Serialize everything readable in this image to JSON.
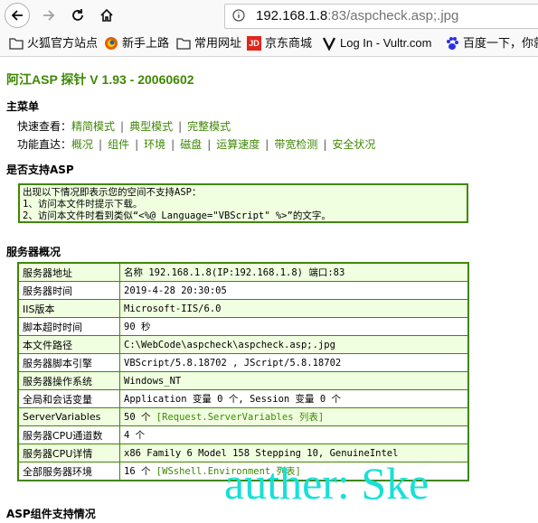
{
  "browser": {
    "url_host": "192.168.1.8",
    "url_rest": ":83/aspcheck.asp;.jpg"
  },
  "bookmarks": [
    {
      "label": "火狐官方站点",
      "icon": "folder-icon"
    },
    {
      "label": "新手上路",
      "icon": "firefox-icon"
    },
    {
      "label": "常用网址",
      "icon": "folder-icon"
    },
    {
      "label": "京东商城",
      "icon": "jd-icon"
    },
    {
      "label": "Log In - Vultr.com",
      "icon": "vultr-icon"
    },
    {
      "label": "百度一下，你就",
      "icon": "baidu-icon"
    }
  ],
  "page": {
    "title": "阿江ASP 探针 V 1.93 - 20060602",
    "main_menu_heading": "主菜单",
    "quick_view_label": "快速查看：",
    "quick_view_links": [
      "精简模式",
      "典型模式",
      "完整模式"
    ],
    "func_label": "功能直达：",
    "func_links": [
      "概况",
      "组件",
      "环境",
      "磁盘",
      "运算速度",
      "带宽检测",
      "安全状况"
    ],
    "asp_support_heading": "是否支持ASP",
    "notice_lines": [
      "出现以下情况即表示您的空间不支持ASP：",
      "1、访问本文件时提示下载。",
      "2、访问本文件时看到类似“<%@ Language=\"VBScript\" %>”的文字。"
    ],
    "server_overview_heading": "服务器概况",
    "server_rows": [
      {
        "key": "服务器地址",
        "value": "名称 192.168.1.8(IP:192.168.1.8) 端口:83",
        "link": ""
      },
      {
        "key": "服务器时间",
        "value": "2019-4-28 20:30:05",
        "link": ""
      },
      {
        "key": "IIS版本",
        "value": "Microsoft-IIS/6.0",
        "link": ""
      },
      {
        "key": "脚本超时时间",
        "value": "90 秒",
        "link": ""
      },
      {
        "key": "本文件路径",
        "value": "C:\\WebCode\\aspcheck\\aspcheck.asp;.jpg",
        "link": ""
      },
      {
        "key": "服务器脚本引擎",
        "value": "VBScript/5.8.18702 , JScript/5.8.18702",
        "link": ""
      },
      {
        "key": "服务器操作系统",
        "value": "Windows_NT",
        "link": ""
      },
      {
        "key": "全局和会话变量",
        "value": "Application 变量 0 个, Session 变量 0 个",
        "link": ""
      },
      {
        "key": "ServerVariables",
        "value": "50 个 ",
        "link": "[Request.ServerVariables 列表]"
      },
      {
        "key": "服务器CPU通道数",
        "value": "4 个",
        "link": ""
      },
      {
        "key": "服务器CPU详情",
        "value": "x86 Family 6 Model 158 Stepping 10, GenuineIntel",
        "link": ""
      },
      {
        "key": "全部服务器环境",
        "value": "16 个 ",
        "link": "[WSshell.Environment 列表]"
      }
    ],
    "component_heading": "ASP组件支持情况"
  },
  "watermark": "auther: Ske",
  "colors": {
    "accent": "#3f8805",
    "cell_bg": "#f0ffe0",
    "watermark": "#17e0d6"
  }
}
